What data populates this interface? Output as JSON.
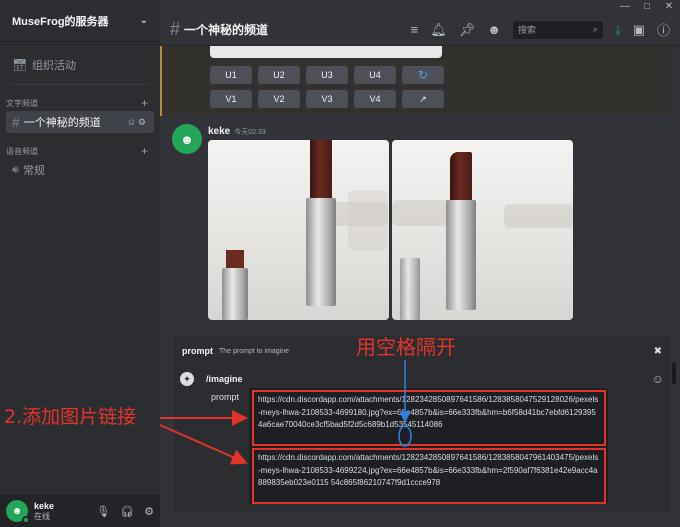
{
  "window": {
    "controls": [
      "—",
      "□",
      "✕"
    ]
  },
  "server": {
    "name": "MuseFrog的服务器"
  },
  "sidebar": {
    "events_label": "组织活动",
    "text_category": "文字频道",
    "voice_category": "语音频道",
    "active_channel": "一个神秘的频道",
    "voice_channel": "常规"
  },
  "header": {
    "channel_title": "一个神秘的频道",
    "search_placeholder": "搜索"
  },
  "buttons": {
    "row1": [
      "U1",
      "U2",
      "U3",
      "U4"
    ],
    "row2": [
      "V1",
      "V2",
      "V3",
      "V4"
    ]
  },
  "message": {
    "author": "keke",
    "time": "今天02:33"
  },
  "prompt_panel": {
    "key": "prompt",
    "description": "The prompt to imagine",
    "command": "/imagine",
    "field_label": "prompt",
    "link1": "https://cdn.discordapp.com/attachments/1282342850897641586/1283858047529128026/pexels-meys-lhwa-2108533-4699180.jpg?ex=66e4857b&is=66e333fb&hm=b6f58d41bc7ebfd61293954a6cae70040ce3cf5bad5f2d5c689b1d53545114086",
    "link2": "https://cdn.discordapp.com/attachments/1282342850897641586/1283858047961403475/pexels-meys-lhwa-2108533-4699224.jpg?ex=66e4857b&is=66e333fb&hm=2f590af7f6381e42e9acc4a889835eb023e0115 54c865f86210747f9d1ccce978"
  },
  "annotations": {
    "top": "用空格隔开",
    "left": "2.添加图片链接"
  },
  "user": {
    "name": "keke",
    "status": "在线"
  },
  "colors": {
    "accent_red": "#e5332a",
    "online": "#23a55a",
    "link_blue": "#4aa3f0"
  }
}
